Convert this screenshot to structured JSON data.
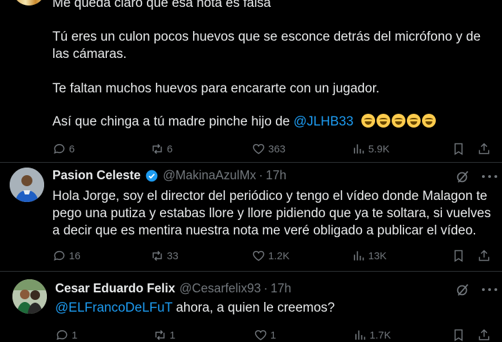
{
  "tweet1": {
    "line_partial": "Me queda claro que esa nota es falsa",
    "para2_line1": "Tú eres un culon pocos huevos que se esconce detrás del micrófono y de",
    "para2_line2": "las cámaras.",
    "para3": "Te faltan muchos huevos para encararte con un jugador.",
    "para4_prefix": "Así que chinga a tú madre pinche hijo de ",
    "para4_mention": "@JLHB33",
    "emoji_count": 5,
    "stats": {
      "replies": "6",
      "reposts": "6",
      "likes": "363",
      "views": "5.9K"
    }
  },
  "tweet2": {
    "name": "Pasion Celeste",
    "handle": "@MakinaAzulMx",
    "sep": "·",
    "time": "17h",
    "line1": "Hola Jorge, soy el director del periódico y tengo el vídeo donde Malagon te",
    "line2": "pego una putiza y estabas llore y llore pidiendo que ya te soltara, si vuelves",
    "line3": "a decir que es mentira nuestra nota me veré obligado a publicar el vídeo.",
    "stats": {
      "replies": "16",
      "reposts": "33",
      "likes": "1.2K",
      "views": "13K"
    }
  },
  "tweet3": {
    "name": "Cesar Eduardo Felix",
    "handle": "@Cesarfelix93",
    "sep": "·",
    "time": "17h",
    "mention": "@ELFrancoDeLFuT",
    "text": " ahora, a quien le creemos?",
    "stats": {
      "replies": "1",
      "reposts": "1",
      "likes": "1",
      "views": "1.7K"
    }
  },
  "colors": {
    "accent": "#1d9bf0",
    "muted": "#71767b",
    "text": "#e7e9ea",
    "verified": "#1d9bf0",
    "bg": "#000000"
  }
}
